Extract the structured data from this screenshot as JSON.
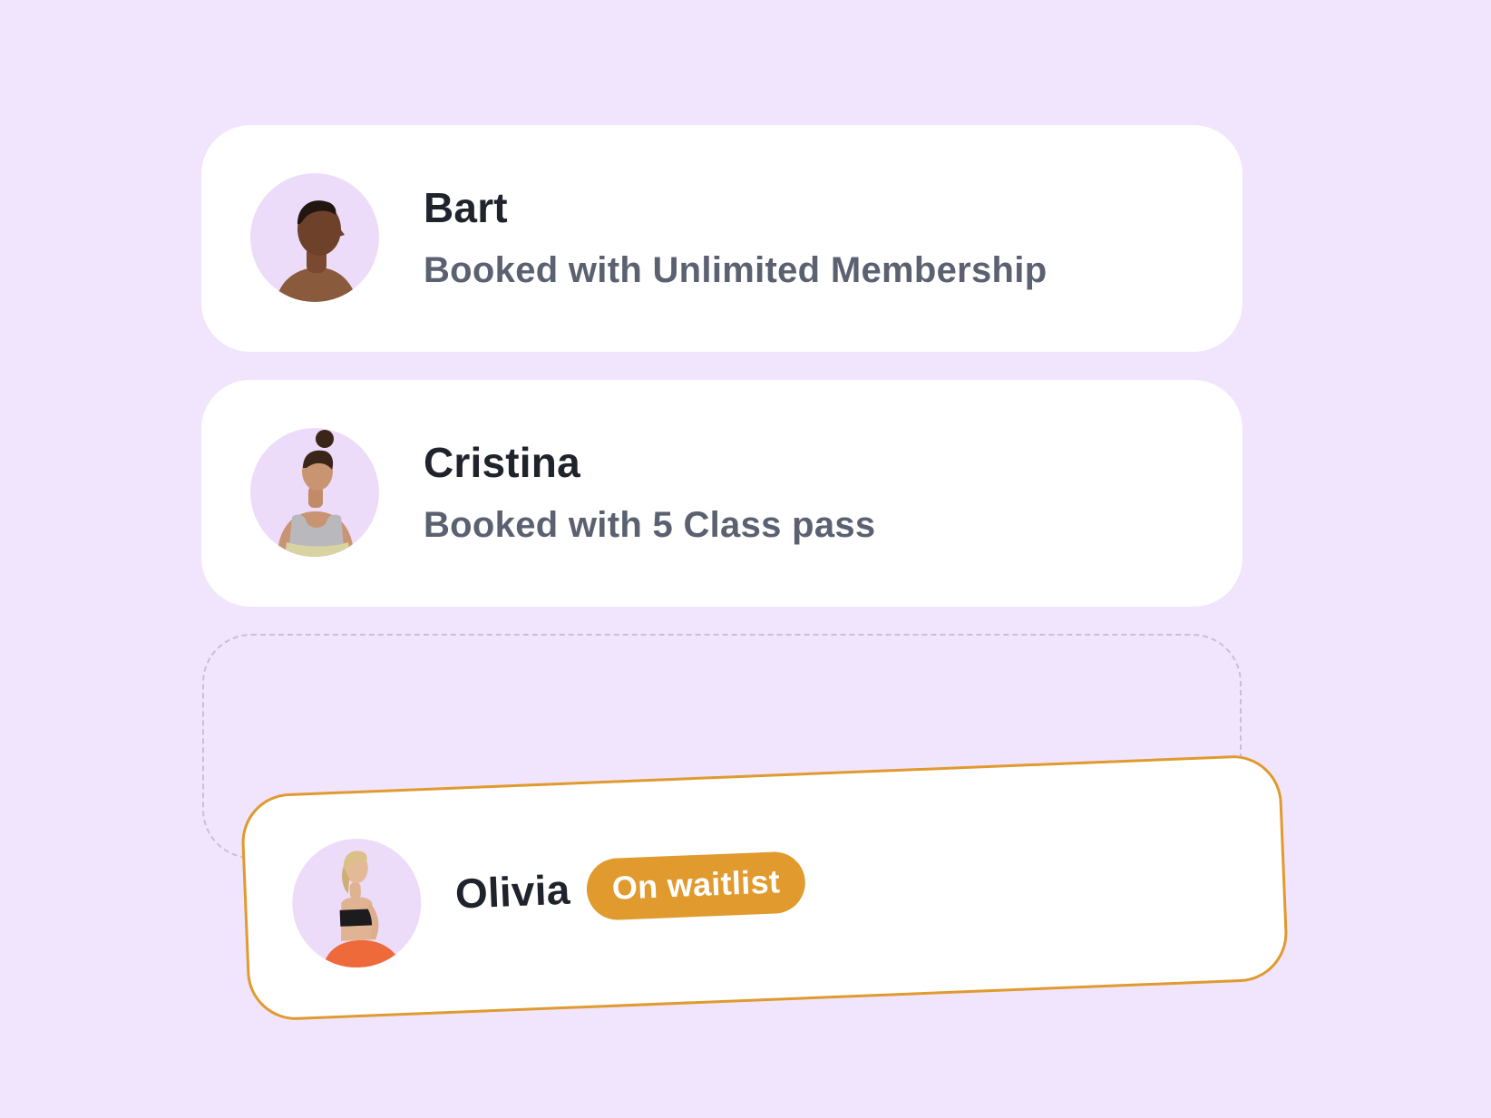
{
  "colors": {
    "background": "#f1e4fd",
    "card": "#ffffff",
    "avatar_bg": "#ecdcfa",
    "accent": "#e09a2e",
    "name_text": "#1f232b",
    "sub_text": "#5b6170"
  },
  "bookings": [
    {
      "name": "Bart",
      "detail": "Booked with Unlimited Membership",
      "avatar": "person-bart-photo"
    },
    {
      "name": "Cristina",
      "detail": "Booked with 5 Class pass",
      "avatar": "person-cristina-photo"
    }
  ],
  "waitlist": {
    "name": "Olivia",
    "badge": "On waitlist",
    "avatar": "person-olivia-photo"
  }
}
